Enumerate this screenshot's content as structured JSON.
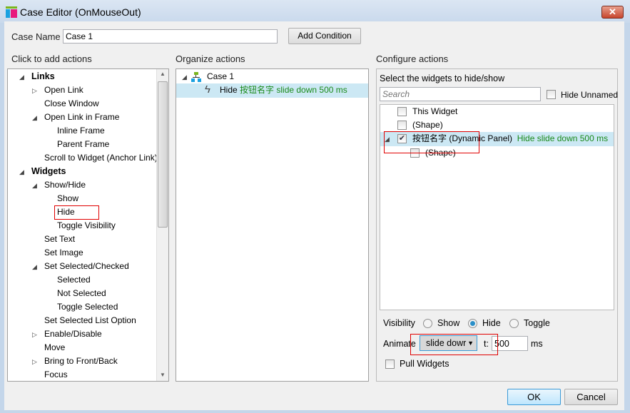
{
  "window": {
    "title": "Case Editor (OnMouseOut)",
    "close": "✕"
  },
  "case_name": {
    "label": "Case Name",
    "value": "Case 1",
    "add_condition": "Add Condition"
  },
  "left": {
    "heading": "Click to add actions",
    "items": [
      {
        "label": "Links",
        "level": 0,
        "bold": true,
        "arrow": "expanded"
      },
      {
        "label": "Open Link",
        "level": 1,
        "arrow": "collapsed"
      },
      {
        "label": "Close Window",
        "level": 1
      },
      {
        "label": "Open Link in Frame",
        "level": 1,
        "arrow": "expanded"
      },
      {
        "label": "Inline Frame",
        "level": 2
      },
      {
        "label": "Parent Frame",
        "level": 2
      },
      {
        "label": "Scroll to Widget (Anchor Link)",
        "level": 1
      },
      {
        "label": "Widgets",
        "level": 0,
        "bold": true,
        "arrow": "expanded"
      },
      {
        "label": "Show/Hide",
        "level": 1,
        "arrow": "expanded"
      },
      {
        "label": "Show",
        "level": 2
      },
      {
        "label": "Hide",
        "level": 2,
        "highlighted": true
      },
      {
        "label": "Toggle Visibility",
        "level": 2
      },
      {
        "label": "Set Text",
        "level": 1
      },
      {
        "label": "Set Image",
        "level": 1
      },
      {
        "label": "Set Selected/Checked",
        "level": 1,
        "arrow": "expanded"
      },
      {
        "label": "Selected",
        "level": 2
      },
      {
        "label": "Not Selected",
        "level": 2
      },
      {
        "label": "Toggle Selected",
        "level": 2
      },
      {
        "label": "Set Selected List Option",
        "level": 1
      },
      {
        "label": "Enable/Disable",
        "level": 1,
        "arrow": "collapsed"
      },
      {
        "label": "Move",
        "level": 1
      },
      {
        "label": "Bring to Front/Back",
        "level": 1,
        "arrow": "collapsed"
      },
      {
        "label": "Focus",
        "level": 1
      }
    ]
  },
  "middle": {
    "heading": "Organize actions",
    "case_label": "Case 1",
    "action": {
      "verb": "Hide",
      "detail": "按钮名字 slide down 500 ms"
    }
  },
  "right": {
    "heading": "Configure actions",
    "instruction": "Select the widgets to hide/show",
    "search_placeholder": "Search",
    "hide_unnamed": "Hide Unnamed",
    "widgets": [
      {
        "label": "This Widget",
        "checked": false
      },
      {
        "label": "(Shape)",
        "checked": false
      },
      {
        "label": "按钮名字 (Dynamic Panel)",
        "checked": true,
        "note": "Hide slide down 500 ms",
        "selected": true
      },
      {
        "label": "(Shape)",
        "checked": false,
        "child": true
      }
    ],
    "visibility": {
      "label": "Visibility",
      "options": [
        "Show",
        "Hide",
        "Toggle"
      ],
      "selected": "Hide"
    },
    "animate": {
      "label": "Animate",
      "value": "slide dowr",
      "t_label": "t:",
      "duration": "500",
      "unit": "ms"
    },
    "pull_widgets": "Pull Widgets"
  },
  "buttons": {
    "ok": "OK",
    "cancel": "Cancel"
  },
  "colors": {
    "selection": "#cce8f4",
    "green": "#1a8a1a",
    "highlight": "#e00000"
  }
}
